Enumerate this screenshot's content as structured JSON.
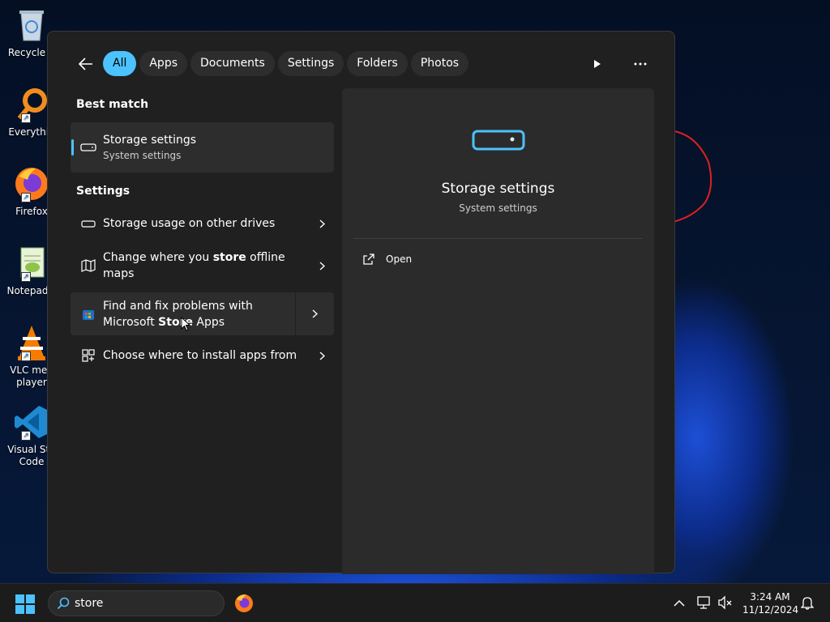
{
  "desktop": {
    "icons": [
      {
        "label": "Recycle B",
        "icon": "recycle-bin-icon"
      },
      {
        "label": "Everythin",
        "icon": "everything-search-icon"
      },
      {
        "label": "Firefox",
        "icon": "firefox-icon"
      },
      {
        "label": "Notepad+",
        "icon": "notepad-plus-plus-icon"
      },
      {
        "label": "VLC med player",
        "icon": "vlc-icon"
      },
      {
        "label": "Visual Stu Code",
        "icon": "vscode-icon"
      }
    ]
  },
  "search": {
    "filters": [
      {
        "label": "All",
        "active": true
      },
      {
        "label": "Apps",
        "active": false
      },
      {
        "label": "Documents",
        "active": false
      },
      {
        "label": "Settings",
        "active": false
      },
      {
        "label": "Folders",
        "active": false
      },
      {
        "label": "Photos",
        "active": false
      }
    ],
    "best_match_label": "Best match",
    "best_match": {
      "title": "Storage settings",
      "subtitle": "System settings"
    },
    "settings_label": "Settings",
    "settings_items": [
      {
        "pre": "Storage usage on other drives",
        "bold": "",
        "post": "",
        "icon": "drive-icon"
      },
      {
        "pre": "Change where you ",
        "bold": "store",
        "post": " offline maps",
        "icon": "map-icon"
      },
      {
        "pre": "Find and fix problems with Microsoft ",
        "bold": "Store",
        "post": " Apps",
        "icon": "store-icon"
      },
      {
        "pre": "Choose where to install apps from",
        "bold": "",
        "post": "",
        "icon": "apps-icon"
      }
    ],
    "preview": {
      "title": "Storage settings",
      "subtitle": "System settings",
      "action": "Open"
    }
  },
  "taskbar": {
    "search_value": "store",
    "clock_time": "3:24 AM",
    "clock_date": "11/12/2024"
  },
  "colors": {
    "accent": "#4cc2ff",
    "panel": "#202020",
    "preview": "#2b2b2b"
  }
}
